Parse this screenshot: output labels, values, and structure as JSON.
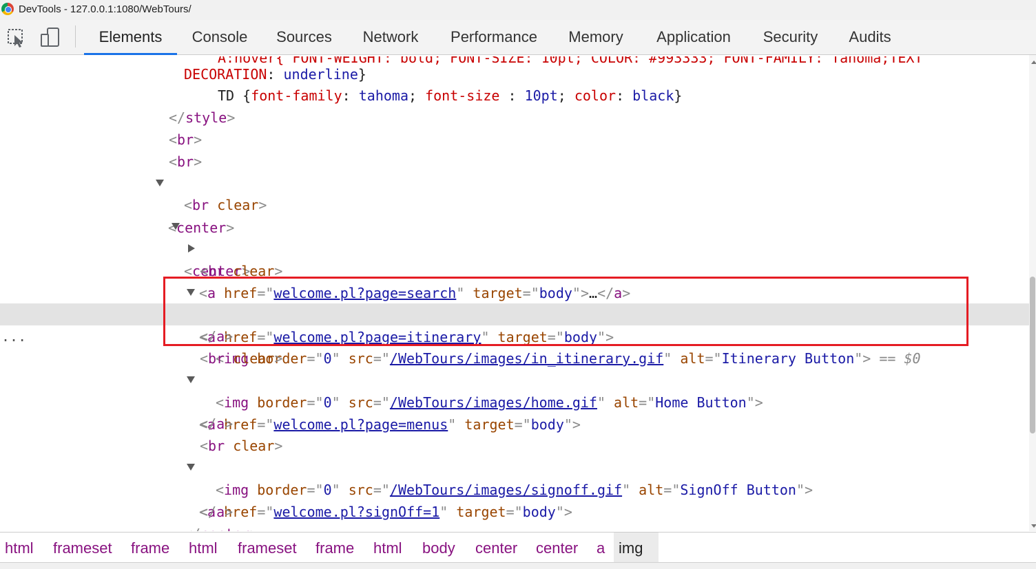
{
  "window": {
    "title": "DevTools - 127.0.0.1:1080/WebTours/"
  },
  "toolbar": {
    "inspect_icon": "inspect-cursor-icon",
    "device_icon": "device-toggle-icon",
    "tabs": [
      "Elements",
      "Console",
      "Sources",
      "Network",
      "Performance",
      "Memory",
      "Application",
      "Security",
      "Audits"
    ],
    "active_tab": "Elements"
  },
  "tree": {
    "css_top_cut": "A:hover{ FONT-WEIGHT: bold; FONT-SIZE: 10pt; COLOR: #993333; FONT-FAMILY: Tahoma;TEXT",
    "css_decoration_prop": "DECORATION",
    "css_decoration_val": "underline",
    "td_selector": "TD",
    "td_prop1": "font-family",
    "td_val1": "tahoma",
    "td_prop2": "font-size",
    "td_val2": "10pt",
    "td_prop3": "color",
    "td_val3": "black",
    "tag_style": "style",
    "tag_br": "br",
    "tag_center": "center",
    "tag_a": "a",
    "tag_img": "img",
    "attr_clear": "clear",
    "attr_href": "href",
    "attr_target": "target",
    "attr_border": "border",
    "attr_src": "src",
    "attr_alt": "alt",
    "val_body": "body",
    "val_zero": "0",
    "link_search": "welcome.pl?page=search",
    "link_itinerary": "welcome.pl?page=itinerary",
    "link_menus": "welcome.pl?page=menus",
    "link_signoff": "welcome.pl?signOff=1",
    "src_itinerary": "/WebTours/images/in_itinerary.gif",
    "src_home": "/WebTours/images/home.gif",
    "src_signoff": "/WebTours/images/signoff.gif",
    "alt_itinerary": "Itinerary Button",
    "alt_home": "Home Button",
    "alt_signoff": "SignOff Button",
    "ellipsis": "…",
    "selected_marker": "== $0",
    "row_dots": "..."
  },
  "breadcrumb": [
    "html",
    "frameset",
    "frame",
    "html",
    "frameset",
    "frame",
    "html",
    "body",
    "center",
    "center",
    "a",
    "img"
  ],
  "breadcrumb_active": "img",
  "colors": {
    "accent": "#1a73e8",
    "highlight": "#e51c23",
    "tag": "#881280",
    "attr": "#994500",
    "value": "#1a1aa6"
  }
}
